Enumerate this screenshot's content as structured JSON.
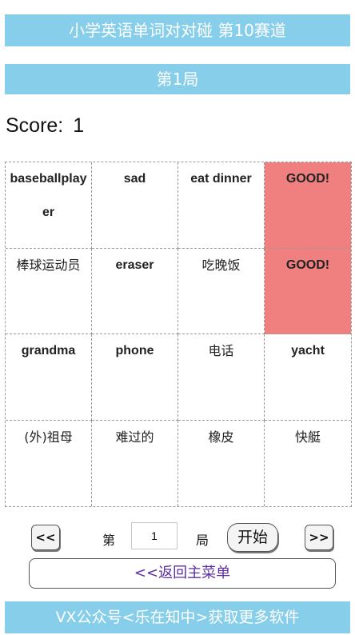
{
  "header": {
    "title": "小学英语单词对对碰   第10赛道",
    "round_title": "第1局"
  },
  "score": {
    "label": "Score:",
    "value": "1"
  },
  "grid": {
    "cells": [
      {
        "text": "baseballplayer",
        "matched": false
      },
      {
        "text": "sad",
        "matched": false
      },
      {
        "text": "eat dinner",
        "matched": false
      },
      {
        "text": "GOOD!",
        "matched": true
      },
      {
        "text": "棒球运动员",
        "matched": false
      },
      {
        "text": "eraser",
        "matched": false
      },
      {
        "text": "吃晚饭",
        "matched": false
      },
      {
        "text": "GOOD!",
        "matched": true
      },
      {
        "text": "grandma",
        "matched": false
      },
      {
        "text": "phone",
        "matched": false
      },
      {
        "text": "电话",
        "matched": false
      },
      {
        "text": "yacht",
        "matched": false
      },
      {
        "text": "(外)祖母",
        "matched": false
      },
      {
        "text": "难过的",
        "matched": false
      },
      {
        "text": "橡皮",
        "matched": false
      },
      {
        "text": "快艇",
        "matched": false
      }
    ],
    "matched_color": "#f08080"
  },
  "controls": {
    "prev_label": "<<",
    "round_prefix": "第",
    "round_value": "1",
    "round_suffix": "局",
    "start_label": "开始",
    "next_label": ">>"
  },
  "menu": {
    "back_label": "<<返回主菜单"
  },
  "footer": {
    "text": "VX公众号<乐在知中>获取更多软件"
  },
  "colors": {
    "accent_bar": "#87ceeb",
    "menu_text": "#5a2ea6"
  }
}
